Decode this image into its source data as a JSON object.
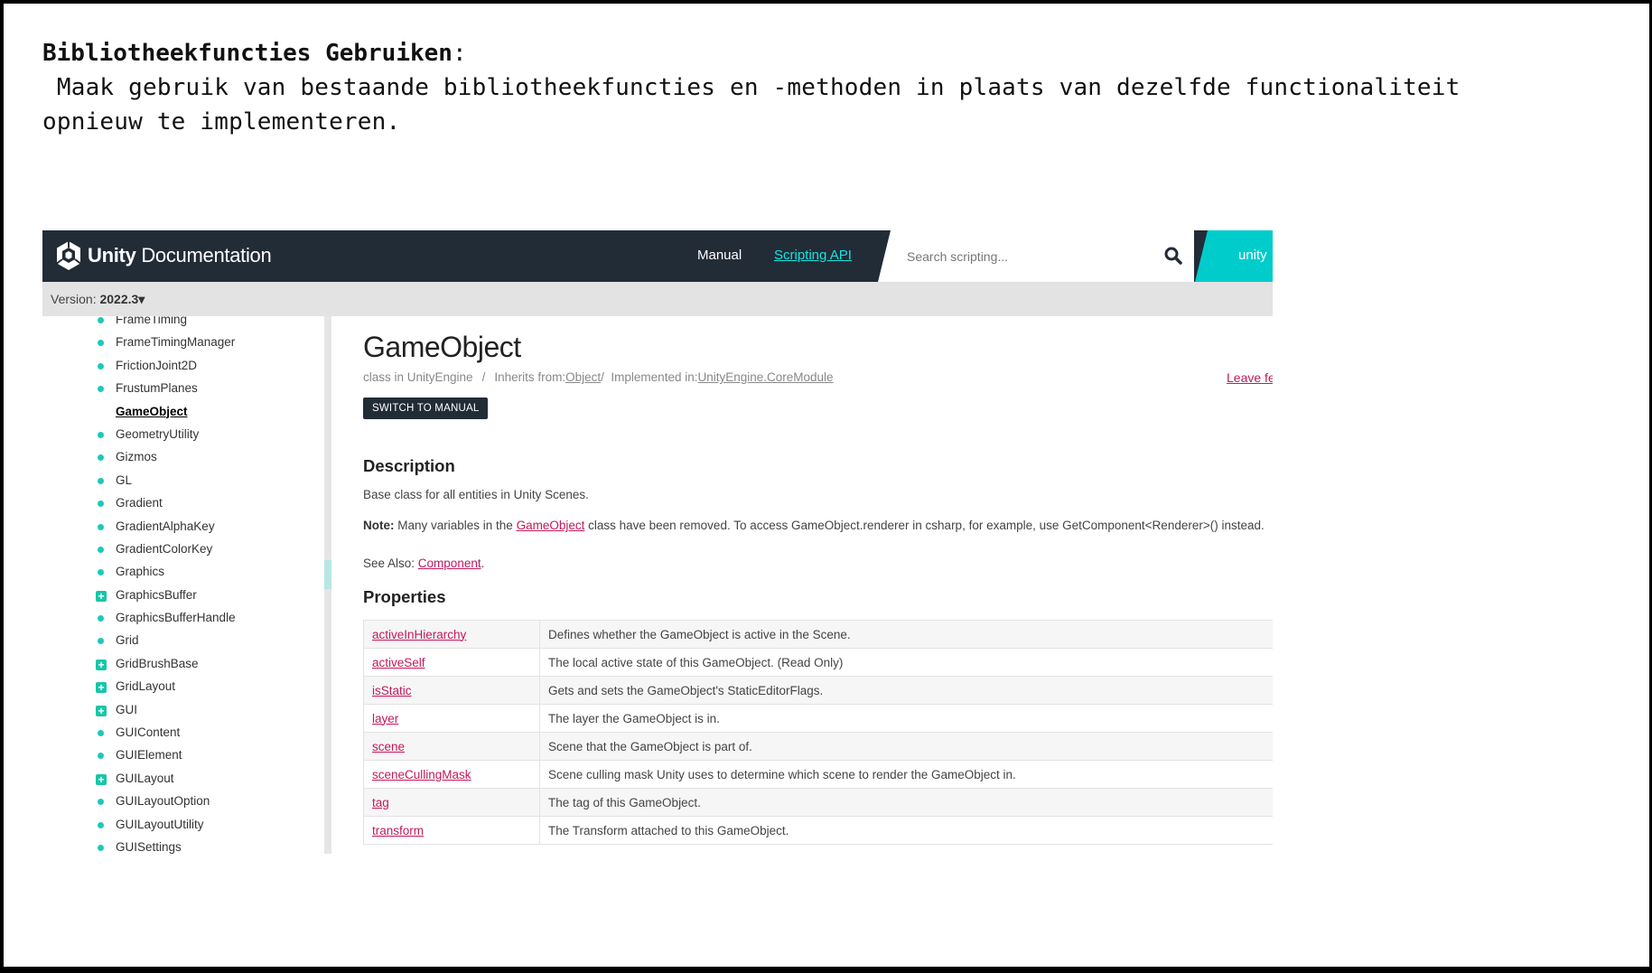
{
  "slide": {
    "title_bold": "Bibliotheekfuncties Gebruiken",
    "title_suffix": ":",
    "body_line1": " Maak gebruik van bestaande bibliotheekfuncties en -methoden in plaats van dezelfde functionaliteit",
    "body_line2": "opnieuw te implementeren."
  },
  "header": {
    "logo_bold": "Unity",
    "logo_rest": " Documentation",
    "nav_manual": "Manual",
    "nav_scripting_api": "Scripting API",
    "search_placeholder": "Search scripting...",
    "search_icon": "search-icon",
    "unity_tab": "unity"
  },
  "version": {
    "label": "Version:",
    "value": "2022.3▾"
  },
  "sidebar": {
    "items": [
      {
        "label": "FrameTiming",
        "marker": "dot"
      },
      {
        "label": "FrameTimingManager",
        "marker": "dot"
      },
      {
        "label": "FrictionJoint2D",
        "marker": "dot"
      },
      {
        "label": "FrustumPlanes",
        "marker": "dot"
      },
      {
        "label": "GameObject",
        "marker": "none",
        "active": true
      },
      {
        "label": "GeometryUtility",
        "marker": "dot"
      },
      {
        "label": "Gizmos",
        "marker": "dot"
      },
      {
        "label": "GL",
        "marker": "dot"
      },
      {
        "label": "Gradient",
        "marker": "dot"
      },
      {
        "label": "GradientAlphaKey",
        "marker": "dot"
      },
      {
        "label": "GradientColorKey",
        "marker": "dot"
      },
      {
        "label": "Graphics",
        "marker": "dot"
      },
      {
        "label": "GraphicsBuffer",
        "marker": "plus"
      },
      {
        "label": "GraphicsBufferHandle",
        "marker": "dot"
      },
      {
        "label": "Grid",
        "marker": "dot"
      },
      {
        "label": "GridBrushBase",
        "marker": "plus"
      },
      {
        "label": "GridLayout",
        "marker": "plus"
      },
      {
        "label": "GUI",
        "marker": "plus"
      },
      {
        "label": "GUIContent",
        "marker": "dot"
      },
      {
        "label": "GUIElement",
        "marker": "dot"
      },
      {
        "label": "GUILayout",
        "marker": "plus"
      },
      {
        "label": "GUILayoutOption",
        "marker": "dot"
      },
      {
        "label": "GUILayoutUtility",
        "marker": "dot"
      },
      {
        "label": "GUISettings",
        "marker": "dot"
      }
    ]
  },
  "main": {
    "title": "GameObject",
    "meta_class": "class in UnityEngine",
    "meta_sep": "/",
    "meta_inherits": "Inherits from:",
    "meta_inherits_link": "Object",
    "meta_slash": "/",
    "meta_implemented": "Implemented in:",
    "meta_implemented_link": "UnityEngine.CoreModule",
    "leave_feedback": "Leave fe",
    "switch_button": "SWITCH TO MANUAL",
    "description_title": "Description",
    "description_text": "Base class for all entities in Unity Scenes.",
    "note_label": "Note:",
    "note_pre": " Many variables in the ",
    "note_link": "GameObject",
    "note_post": " class have been removed. To access GameObject.renderer in csharp, for example, use GetComponent<Renderer>() instead.",
    "see_also_label": "See Also: ",
    "see_also_link": "Component",
    "see_also_end": ".",
    "properties_title": "Properties",
    "properties": [
      {
        "name": "activeInHierarchy",
        "desc": "Defines whether the GameObject is active in the Scene."
      },
      {
        "name": "activeSelf",
        "desc": "The local active state of this GameObject. (Read Only)"
      },
      {
        "name": "isStatic",
        "desc": "Gets and sets the GameObject's StaticEditorFlags."
      },
      {
        "name": "layer",
        "desc": "The layer the GameObject is in."
      },
      {
        "name": "scene",
        "desc": "Scene that the GameObject is part of."
      },
      {
        "name": "sceneCullingMask",
        "desc": "Scene culling mask Unity uses to determine which scene to render the GameObject in."
      },
      {
        "name": "tag",
        "desc": "The tag of this GameObject."
      },
      {
        "name": "transform",
        "desc": "The Transform attached to this GameObject."
      }
    ]
  },
  "colors": {
    "header_bg": "#222c37",
    "accent_cyan": "#00cccc",
    "link_pink": "#c2185b",
    "tree_dot": "#1ec8bc"
  }
}
